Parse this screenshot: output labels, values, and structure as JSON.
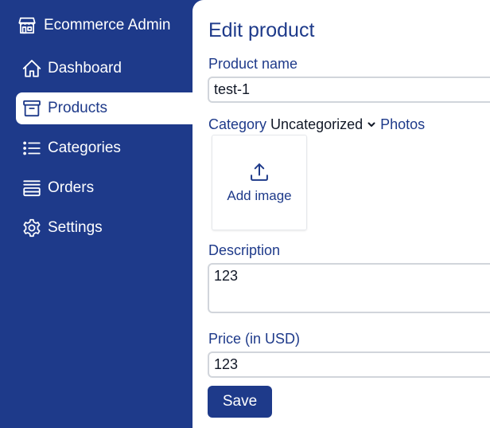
{
  "sidebar": {
    "brand": {
      "label": "Ecommerce Admin",
      "icon": "store-icon"
    },
    "items": [
      {
        "label": "Dashboard",
        "icon": "home-icon",
        "active": false
      },
      {
        "label": "Products",
        "icon": "archive-box-icon",
        "active": true
      },
      {
        "label": "Categories",
        "icon": "list-icon",
        "active": false
      },
      {
        "label": "Orders",
        "icon": "queue-list-icon",
        "active": false
      },
      {
        "label": "Settings",
        "icon": "gear-icon",
        "active": false
      }
    ]
  },
  "main": {
    "title": "Edit product",
    "product_name": {
      "label": "Product name",
      "value": "test-1"
    },
    "category": {
      "label": "Category",
      "selected": "Uncategorized"
    },
    "photos": {
      "label": "Photos",
      "add_image_label": "Add image"
    },
    "description": {
      "label": "Description",
      "value": "123"
    },
    "price": {
      "label": "Price (in USD)",
      "value": "123"
    },
    "save_label": "Save"
  },
  "colors": {
    "primary": "#1e3a8a",
    "background": "#ffffff",
    "border": "#d1d5db"
  }
}
